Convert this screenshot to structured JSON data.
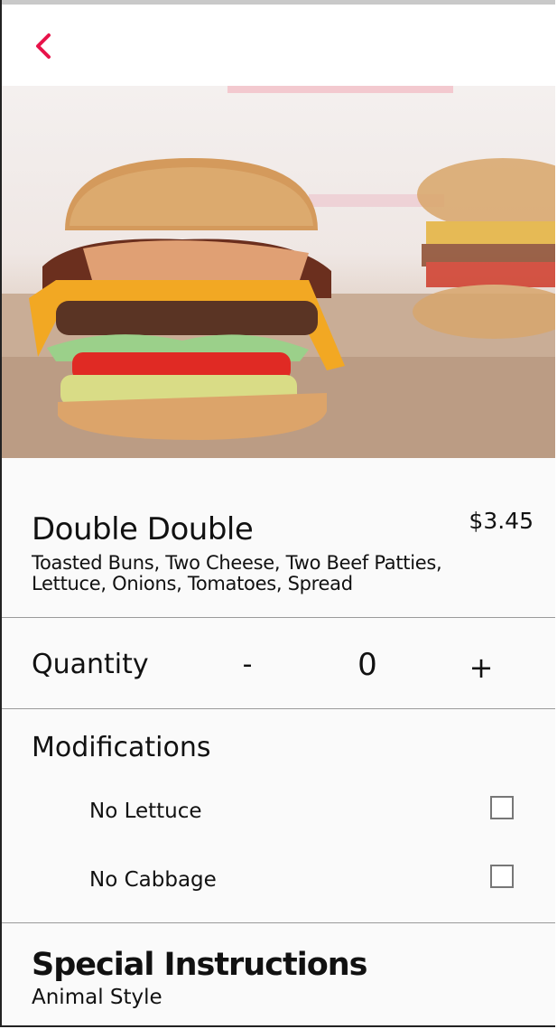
{
  "colors": {
    "accent": "#e8134a",
    "divider": "#9a9a9a",
    "background": "#fafafa"
  },
  "navbar": {
    "back_icon": "chevron-left-icon"
  },
  "hero": {
    "image": "burger-photo"
  },
  "item": {
    "name": "Double Double",
    "price": "$3.45",
    "description": "Toasted Buns, Two Cheese, Two Beef Patties, Lettuce, Onions, Tomatoes, Spread"
  },
  "quantity": {
    "label": "Quantity",
    "minus": "-",
    "value": "0",
    "plus": "+"
  },
  "modifications": {
    "label": "Modifications",
    "options": [
      {
        "label": "No Lettuce",
        "checked": false
      },
      {
        "label": "No Cabbage",
        "checked": false
      }
    ]
  },
  "special_instructions": {
    "title": "Special Instructions",
    "value": "Animal Style"
  }
}
